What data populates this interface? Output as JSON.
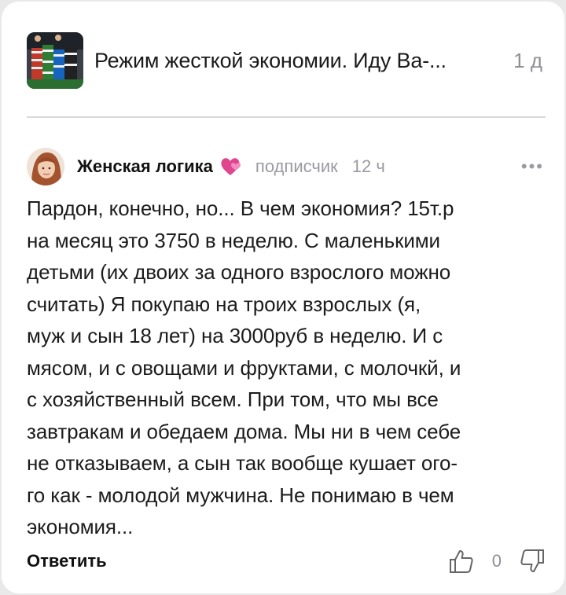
{
  "article": {
    "title": "Режим жесткой экономии. Иду Ва-...",
    "time": "1 д",
    "thumbnail_icon": "casino-chips-thumbnail"
  },
  "comment": {
    "author": "Женская логика",
    "author_emoji": "💕",
    "badge": "подписчик",
    "time": "12 ч",
    "more_label": "•••",
    "text": "Пардон, конечно, но... В чем экономия? 15т.р\nна месяц это 3750 в неделю. С маленькими\nдетьми (их двоих за одного взрослого можно\nсчитать) Я покупаю на троих взрослых (я,\nмуж и сын 18 лет) на 3000руб в неделю. И с\nмясом, и с овощами и фруктами, с молочкй, и\nс хозяйственный всем. При том, что мы все\nзавтракам и обедаем дома. Мы ни в чем себе\nне отказываем, а сын так вообще кушает ого-\nго как - молодой мужчина. Не понимаю в чем\nэкономия..."
  },
  "actions": {
    "reply_label": "Ответить",
    "score": "0",
    "like_icon": "thumbs-up-icon",
    "dislike_icon": "thumbs-down-icon"
  },
  "colors": {
    "background": "#e9e9ea",
    "card": "#ffffff",
    "muted_text": "#9a9aa2",
    "heart": "#e0458f"
  }
}
